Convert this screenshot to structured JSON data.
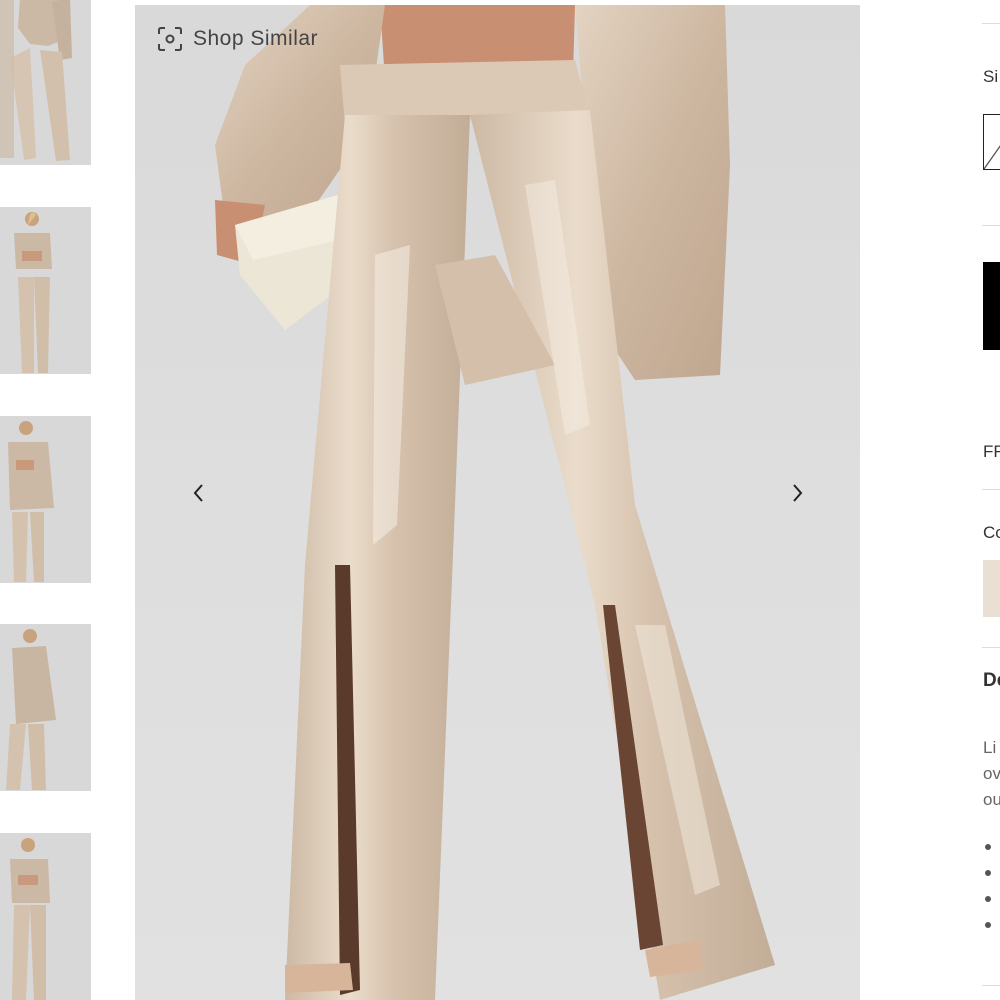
{
  "thumbnails": [
    {
      "alt": "Sequin pants - view 1"
    },
    {
      "alt": "Sequin pants - view 2"
    },
    {
      "alt": "Sequin pants - view 3"
    },
    {
      "alt": "Sequin pants - view 4"
    },
    {
      "alt": "Sequin pants - view 5"
    }
  ],
  "gallery": {
    "shop_similar_label": "Shop Similar",
    "shop_similar_icon": "scan-icon",
    "prev_icon": "chevron-left-icon",
    "next_icon": "chevron-right-icon"
  },
  "panel": {
    "size_label": "Si",
    "shipping_label": "FR",
    "color_label": "Co",
    "description_heading": "De",
    "description_lines": [
      "Li",
      "ov",
      "ou"
    ],
    "bullet_count": 4,
    "swatch_color": "#eadfd3",
    "button_color": "#000000"
  }
}
